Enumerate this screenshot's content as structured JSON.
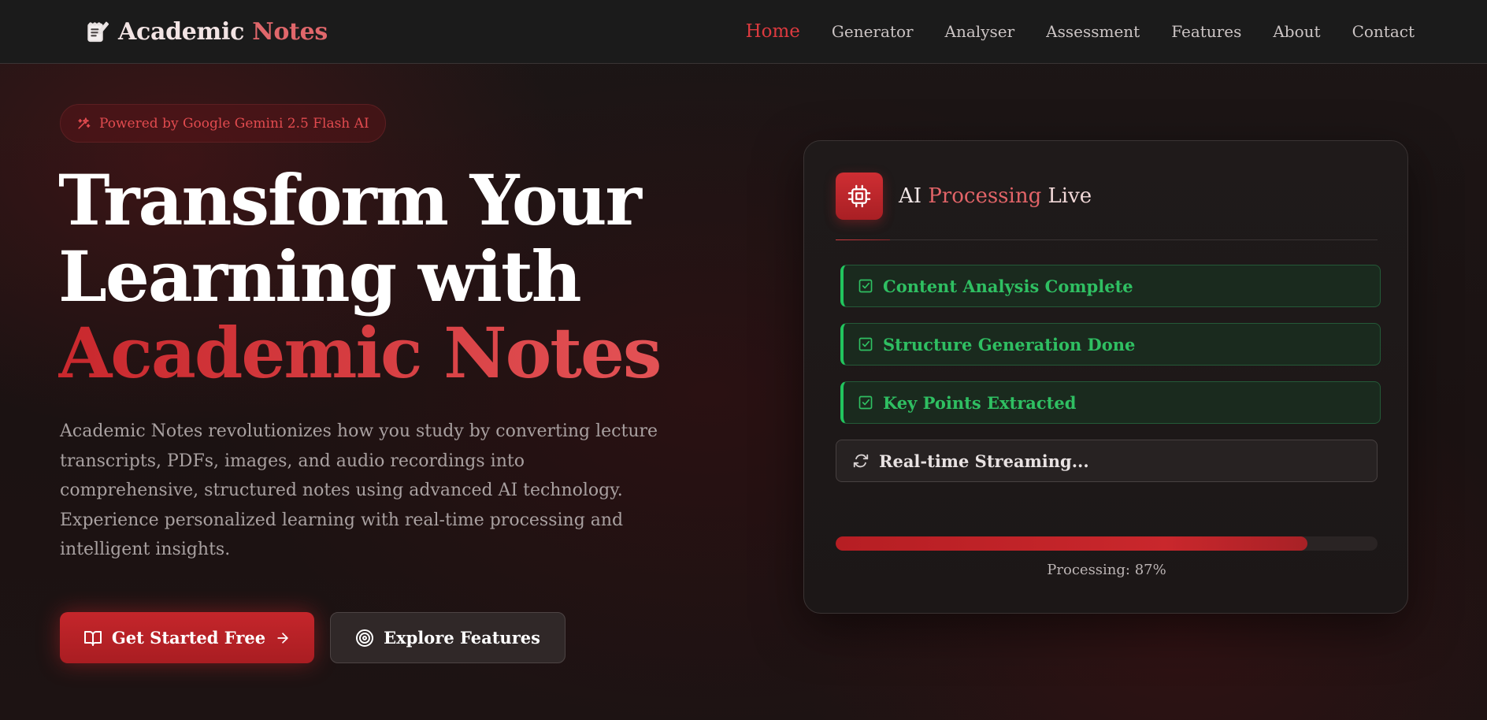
{
  "nav": {
    "brand": {
      "word1": "Academic",
      "word2": "Notes",
      "icon": "notebook-pen-icon"
    },
    "links": [
      {
        "label": "Home",
        "active": true
      },
      {
        "label": "Generator",
        "active": false
      },
      {
        "label": "Analyser",
        "active": false
      },
      {
        "label": "Assessment",
        "active": false
      },
      {
        "label": "Features",
        "active": false
      },
      {
        "label": "About",
        "active": false
      },
      {
        "label": "Contact",
        "active": false
      }
    ]
  },
  "hero": {
    "badge": {
      "icon": "sparkles-icon",
      "text": "Powered by Google Gemini 2.5 Flash AI"
    },
    "headline": {
      "line1": "Transform Your",
      "line2": "Learning with",
      "accent": "Academic Notes"
    },
    "description": "Academic Notes revolutionizes how you study by converting lecture transcripts, PDFs, images, and audio recordings into comprehensive, structured notes using advanced AI technology. Experience personalized learning with real-time processing and intelligent insights.",
    "primary_button": {
      "label": "Get Started Free",
      "icon": "book-open-icon",
      "trailing_icon": "arrow-right-icon"
    },
    "secondary_button": {
      "label": "Explore Features",
      "icon": "target-icon"
    }
  },
  "processing_card": {
    "icon": "cpu-chip-icon",
    "title": {
      "part1": "AI",
      "part2": "Processing",
      "part3": "Live"
    },
    "steps": [
      {
        "label": "Content Analysis Complete",
        "status": "done",
        "icon": "check-square-icon"
      },
      {
        "label": "Structure Generation Done",
        "status": "done",
        "icon": "check-square-icon"
      },
      {
        "label": "Key Points Extracted",
        "status": "done",
        "icon": "check-square-icon"
      },
      {
        "label": "Real-time Streaming...",
        "status": "in-progress",
        "icon": "refresh-icon"
      }
    ],
    "progress": {
      "value": 87,
      "label": "Processing: 87%"
    }
  },
  "colors": {
    "accent": "#dc3a3f",
    "success": "#22c55e",
    "background": "#1a1414"
  }
}
